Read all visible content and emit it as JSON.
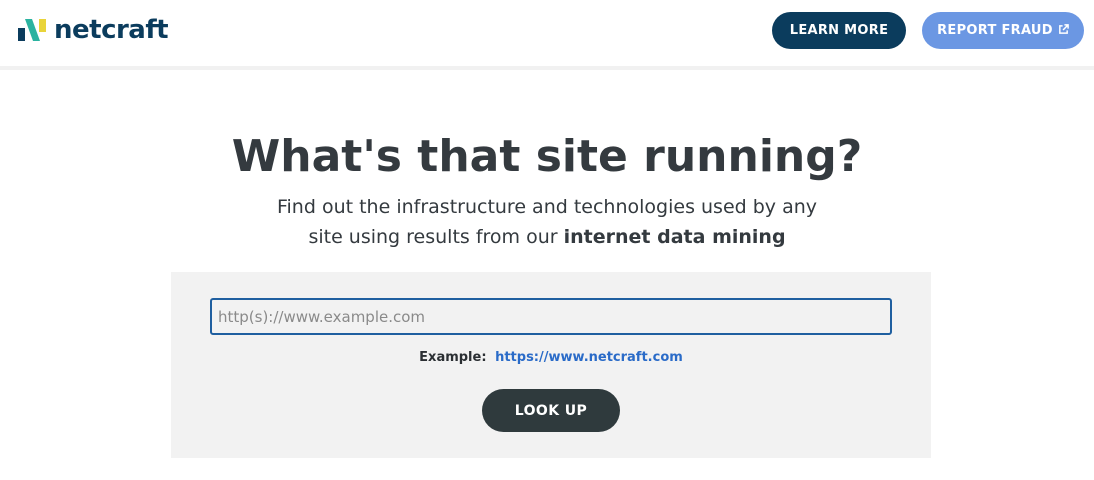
{
  "header": {
    "brand": "netcraft",
    "brand_color": "#0b3c5d",
    "nav": {
      "learn_more": "LEARN MORE",
      "report_fraud": "REPORT FRAUD",
      "report_icon": "external-link-icon"
    }
  },
  "hero": {
    "title": "What's that site running?",
    "subtitle_line1": "Find out the infrastructure and technologies used by any",
    "subtitle_line2_prefix": "site using results from our",
    "subtitle_line2_bold": "internet data mining"
  },
  "search": {
    "placeholder": "http(s)://www.example.com",
    "value": "",
    "example_label": "Example:",
    "example_link": "https://www.netcraft.com",
    "submit_label": "LOOK UP"
  },
  "colors": {
    "primary_dark": "#0b3c5d",
    "accent_blue": "#6b97e3",
    "link_blue": "#2a6bc8",
    "button_dark": "#2f3a3d",
    "panel_bg": "#f2f2f2"
  }
}
